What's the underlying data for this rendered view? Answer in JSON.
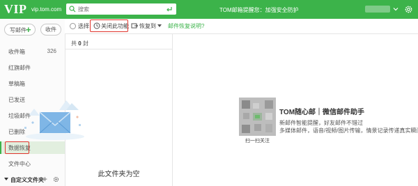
{
  "header": {
    "logo": "VIP",
    "domain": "vip.tom.com",
    "search_placeholder": "搜索",
    "tip": "TOM邮箱提醒您：加强安全防护"
  },
  "sidebar": {
    "write_label": "写邮件",
    "receive_label": "收件",
    "items": [
      {
        "label": "收件箱",
        "count": "326"
      },
      {
        "label": "红旗邮件",
        "count": ""
      },
      {
        "label": "草稿箱",
        "count": ""
      },
      {
        "label": "已发送",
        "count": ""
      },
      {
        "label": "垃圾邮件",
        "count": ""
      },
      {
        "label": "已删除",
        "count": ""
      },
      {
        "label": "数据恢复",
        "count": ""
      },
      {
        "label": "文件中心",
        "count": ""
      }
    ],
    "active_index": 6,
    "custom_folder_label": "自定义文件夹"
  },
  "toolbar": {
    "select_label": "选择",
    "close_feature_label": "关闭此功能",
    "restore_label": "恢复到",
    "help_label": "邮件恢复说明?"
  },
  "list": {
    "count_prefix": "共",
    "count_value": "0",
    "count_suffix": "封",
    "empty_text": "此文件夹为空"
  },
  "promo": {
    "qr_caption": "扫一扫关注",
    "title": "TOM随心邮｜微信邮件助手",
    "lines": [
      "新邮件智能提醒，好友邮件不错过",
      "多媒体邮件，语音/视频/图片传输，情景记录传递真实瞬间"
    ]
  },
  "colors": {
    "brand": "#3cb34a",
    "highlight": "#e0342c"
  }
}
